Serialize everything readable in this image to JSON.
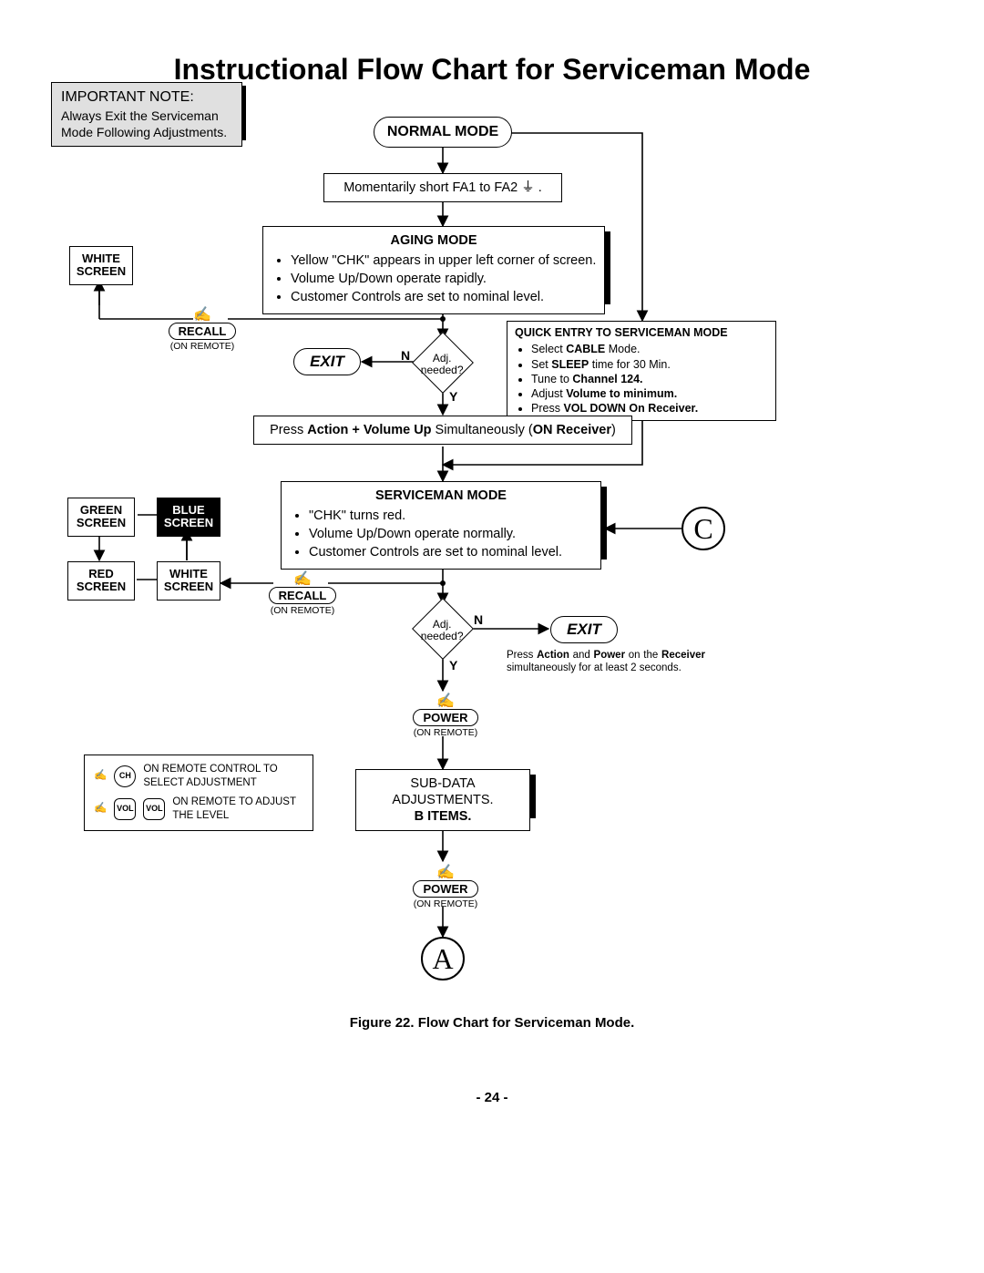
{
  "title": "Instructional Flow Chart for Serviceman Mode",
  "important_note": {
    "heading": "IMPORTANT NOTE:",
    "body": "Always Exit the Serviceman Mode Following Adjustments."
  },
  "normal_mode_label": "NORMAL MODE",
  "momentary_short": "Momentarily short FA1 to FA2  ⏚ .",
  "aging_mode": {
    "heading": "AGING MODE",
    "items": [
      "Yellow \"CHK\" appears in upper left corner of screen.",
      "Volume Up/Down operate rapidly.",
      "Customer Controls are set to nominal level."
    ]
  },
  "quick_entry": {
    "heading": "QUICK ENTRY TO SERVICEMAN MODE",
    "items": [
      "Select CABLE Mode.",
      "Set SLEEP time for 30 Min.",
      "Tune to Channel 124.",
      "Adjust Volume to minimum.",
      "Press VOL DOWN On Receiver."
    ]
  },
  "adj_needed_label": "Adj. needed?",
  "exit_label": "EXIT",
  "press_action_volume": "Press Action + Volume Up Simultaneously (ON Receiver)",
  "serviceman_mode": {
    "heading": "SERVICEMAN MODE",
    "items": [
      "\"CHK\" turns red.",
      "Volume Up/Down operate normally.",
      "Customer Controls are set to nominal level."
    ]
  },
  "recall_label": "RECALL",
  "on_remote_label": "(ON REMOTE)",
  "power_label": "POWER",
  "sub_data": {
    "line1": "SUB-DATA ADJUSTMENTS.",
    "line2": "B ITEMS."
  },
  "legend": {
    "row1": "ON REMOTE CONTROL TO SELECT ADJUSTMENT",
    "row2": "ON REMOTE TO ADJUST THE LEVEL",
    "ch_label": "CH",
    "vol_label": "VOL"
  },
  "exit_instruction": "Press Action and Power on the Receiver simultaneously for at least 2 seconds.",
  "screens": {
    "white": "WHITE\nSCREEN",
    "green": "GREEN\nSCREEN",
    "blue": "BLUE\nSCREEN",
    "red": "RED\nSCREEN"
  },
  "connector_c": "C",
  "connector_a": "A",
  "yn": {
    "y": "Y",
    "n": "N"
  },
  "figure_caption": "Figure 22. Flow Chart for Serviceman Mode.",
  "page_number": "- 24 -"
}
